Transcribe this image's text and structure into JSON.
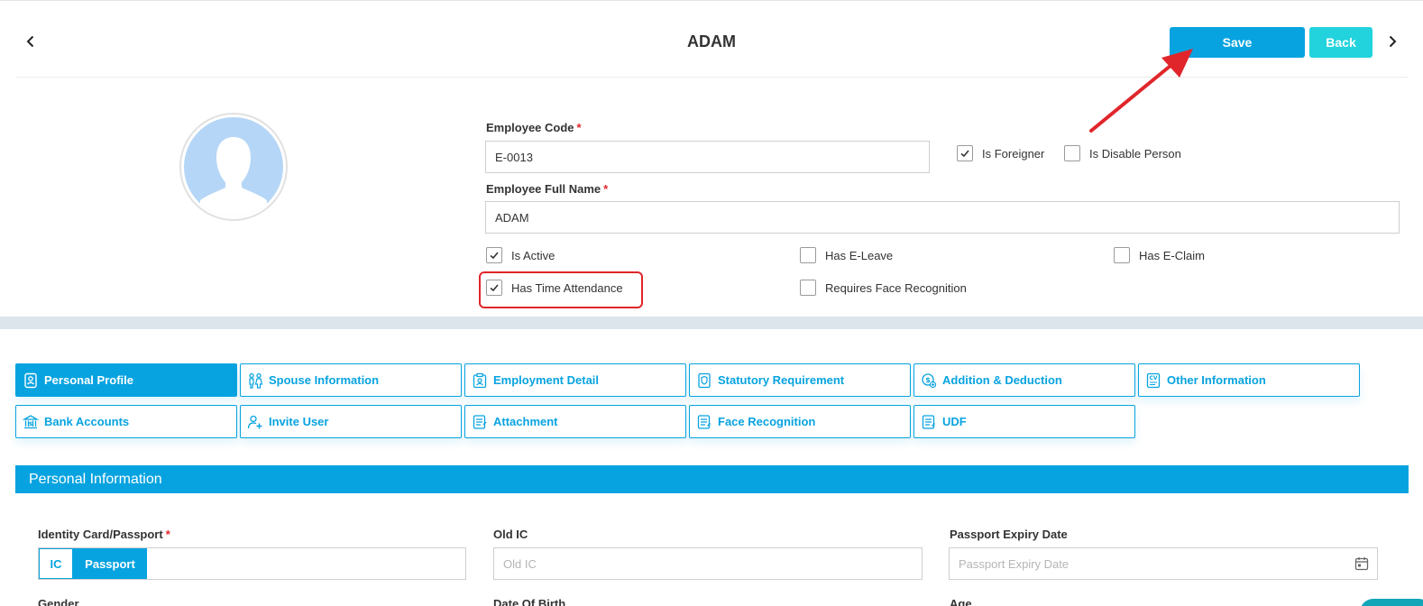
{
  "header": {
    "title": "ADAM",
    "save_label": "Save",
    "back_label": "Back"
  },
  "form": {
    "employee_code": {
      "label": "Employee Code",
      "required": "*",
      "value": "E-0013"
    },
    "employee_full_name": {
      "label": "Employee Full Name",
      "required": "*",
      "value": "ADAM"
    },
    "checkboxes": {
      "is_foreigner": {
        "label": "Is Foreigner",
        "checked": true
      },
      "is_disable_person": {
        "label": "Is Disable Person",
        "checked": false
      },
      "is_active": {
        "label": "Is Active",
        "checked": true
      },
      "has_e_leave": {
        "label": "Has E-Leave",
        "checked": false
      },
      "has_e_claim": {
        "label": "Has E-Claim",
        "checked": false
      },
      "has_time_attendance": {
        "label": "Has Time Attendance",
        "checked": true
      },
      "requires_face_recognition": {
        "label": "Requires Face Recognition",
        "checked": false
      }
    }
  },
  "tabs": [
    {
      "label": "Personal Profile",
      "icon": "profile-icon",
      "active": true
    },
    {
      "label": "Spouse Information",
      "icon": "spouse-icon",
      "active": false
    },
    {
      "label": "Employment Detail",
      "icon": "employment-icon",
      "active": false
    },
    {
      "label": "Statutory Requirement",
      "icon": "statutory-icon",
      "active": false
    },
    {
      "label": "Addition & Deduction",
      "icon": "addition-deduction-icon",
      "active": false
    },
    {
      "label": "Other Information",
      "icon": "cv-icon",
      "active": false
    },
    {
      "label": "Bank Accounts",
      "icon": "bank-icon",
      "active": false
    },
    {
      "label": "Invite User",
      "icon": "invite-user-icon",
      "active": false
    },
    {
      "label": "Attachment",
      "icon": "attachment-icon",
      "active": false
    },
    {
      "label": "Face Recognition",
      "icon": "face-recognition-icon",
      "active": false
    },
    {
      "label": "UDF",
      "icon": "udf-icon",
      "active": false
    }
  ],
  "personal_information": {
    "section_title": "Personal Information",
    "identity": {
      "label": "Identity Card/Passport",
      "required": "*",
      "options": [
        "IC",
        "Passport"
      ],
      "selected": "Passport"
    },
    "old_ic": {
      "label": "Old IC",
      "placeholder": "Old IC"
    },
    "passport_expiry": {
      "label": "Passport Expiry Date",
      "placeholder": "Passport Expiry Date"
    },
    "partial_labels": [
      "Gender",
      "Date Of Birth",
      "Age"
    ]
  },
  "colors": {
    "primary": "#07a3e0",
    "back_button": "#22d3dd",
    "required": "#e0262b",
    "annotation": "#e0262b"
  }
}
